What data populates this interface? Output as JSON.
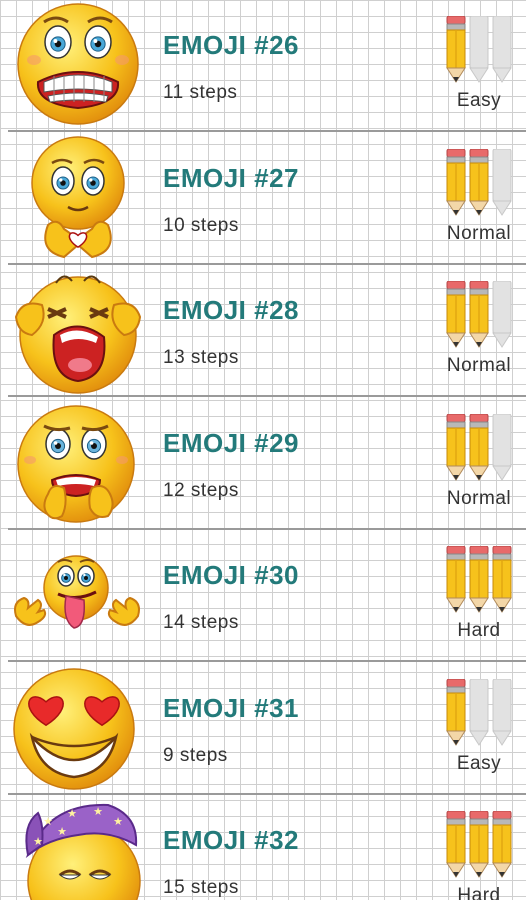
{
  "list": {
    "items": [
      {
        "title": "EMOJI #26",
        "steps": "11 steps",
        "level": "Easy",
        "difficulty": 1,
        "emoji": "grimacing-face-icon"
      },
      {
        "title": "EMOJI #27",
        "steps": "10 steps",
        "level": "Normal",
        "difficulty": 2,
        "emoji": "heart-hands-face-icon"
      },
      {
        "title": "EMOJI #28",
        "steps": "13 steps",
        "level": "Normal",
        "difficulty": 2,
        "emoji": "crying-face-icon"
      },
      {
        "title": "EMOJI #29",
        "steps": "12 steps",
        "level": "Normal",
        "difficulty": 2,
        "emoji": "nervous-face-icon"
      },
      {
        "title": "EMOJI #30",
        "steps": "14 steps",
        "level": "Hard",
        "difficulty": 3,
        "emoji": "tongue-out-face-icon"
      },
      {
        "title": "EMOJI #31",
        "steps": "9 steps",
        "level": "Easy",
        "difficulty": 1,
        "emoji": "heart-eyes-face-icon"
      },
      {
        "title": "EMOJI #32",
        "steps": "15 steps",
        "level": "Hard",
        "difficulty": 3,
        "emoji": "sleepy-nightcap-face-icon"
      }
    ]
  },
  "colors": {
    "title": "#237a7a",
    "face": "#f7c21b",
    "pencil_active": "#f6c21c",
    "pencil_inactive": "#e2e2e2",
    "eraser": "#e86a6a"
  }
}
